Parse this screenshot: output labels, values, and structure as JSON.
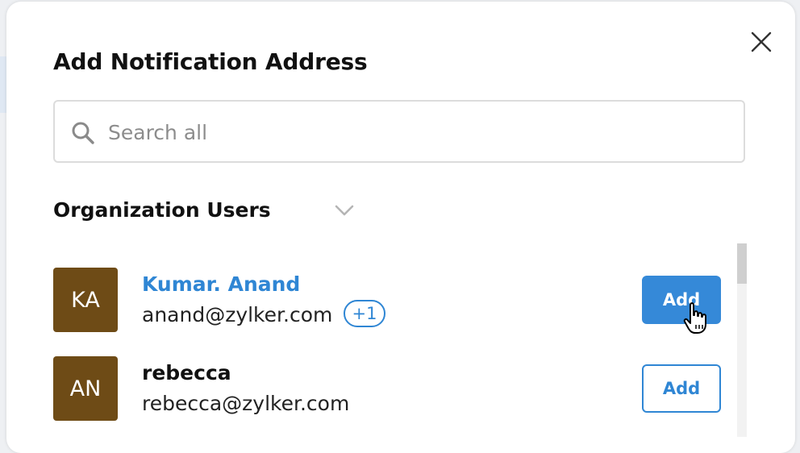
{
  "dialog": {
    "title": "Add Notification Address",
    "close_icon": "close-icon"
  },
  "search": {
    "placeholder": "Search all",
    "value": "",
    "icon": "search-icon"
  },
  "section": {
    "title": "Organization Users",
    "icon": "chevron-down-icon"
  },
  "users": [
    {
      "initials": "KA",
      "name": "Kumar. Anand",
      "email": "anand@zylker.com",
      "extra_badge": "+1",
      "action_label": "Add",
      "highlighted": true
    },
    {
      "initials": "AN",
      "name": "rebecca",
      "email": "rebecca@zylker.com",
      "action_label": "Add",
      "highlighted": false
    }
  ],
  "colors": {
    "accent": "#3589d8",
    "link": "#2f86d4",
    "avatar_bg": "#6e4b16",
    "title_text": "#111111"
  }
}
